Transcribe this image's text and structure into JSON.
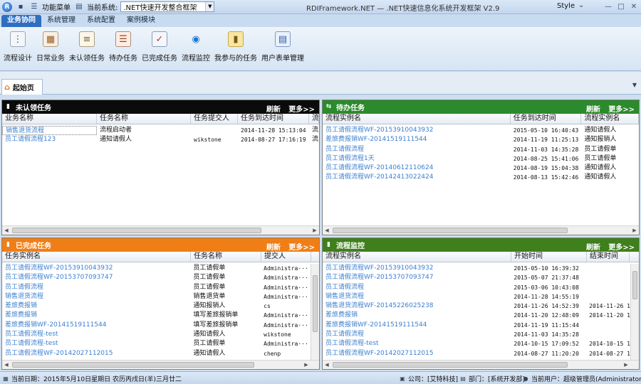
{
  "titlebar": {
    "app_icon": "R",
    "menu_label": "功能菜单",
    "system_label": "当前系统:",
    "system_value": ".NET快速开发整合框架",
    "title": "RDIFramework.NET — .NET快速信息化系统开发框架 V2.9",
    "style_label": "Style",
    "icons": [
      "logo-icon",
      "save-icon",
      "menu-icon",
      "dropdown-icon",
      "minimize-icon",
      "maximize-icon",
      "close-icon"
    ]
  },
  "ribbon_tabs": [
    "业务协同",
    "系统管理",
    "系统配置",
    "案例模块"
  ],
  "ribbon_buttons": [
    "流程设计",
    "日常业务",
    "未认领任务",
    "待办任务",
    "已完成任务",
    "流程监控",
    "我参与的任务",
    "用户表单管理"
  ],
  "doc_tab": "起始页",
  "panels": {
    "unclaimed": {
      "title": "未认领任务",
      "refresh": "刷新",
      "more": "更多>>",
      "columns": [
        "业务名称",
        "任务名称",
        "任务提交人",
        "任务到达时间",
        "流"
      ],
      "rows": [
        [
          "销售退货流程",
          "流程启动者",
          "",
          "2014-11-28 15:13:04",
          "流"
        ],
        [
          "员工请假流程123",
          "通知请假人",
          "wikstone",
          "2014-08-27 17:16:19",
          "流"
        ]
      ]
    },
    "todo": {
      "title": "待办任务",
      "refresh": "刷新",
      "more": "更多>>",
      "columns": [
        "流程实例名",
        "任务到达时间",
        "流程实例名"
      ],
      "rows": [
        [
          "员工请假流程WF-20153910043932",
          "2015-05-10 16:40:43",
          "通知请假人"
        ],
        [
          "差旅费报销WF-20141519111544",
          "2014-11-19 11:25:13",
          "通知报销人"
        ],
        [
          "员工请假流程",
          "2014-11-03 14:35:28",
          "员工请假单"
        ],
        [
          "员工请假流程1天",
          "2014-08-25 15:41:06",
          "员工请假单"
        ],
        [
          "员工请假流程WF-20140612110624",
          "2014-08-19 15:04:38",
          "通知请假人"
        ],
        [
          "员工请假流程WF-20142413022424",
          "2014-08-13 15:42:46",
          "通知请假人"
        ]
      ]
    },
    "completed": {
      "title": "已完成任务",
      "refresh": "刷新",
      "more": "更多>>",
      "columns": [
        "任务实例名",
        "任务名称",
        "提交人"
      ],
      "rows": [
        [
          "员工请假流程WF-20153910043932",
          "员工请假单",
          "Administra···"
        ],
        [
          "员工请假流程WF-20153707093747",
          "员工请假单",
          "Administra···"
        ],
        [
          "员工请假流程",
          "员工请假单",
          "Administra···"
        ],
        [
          "销售退货流程",
          "销售退货单",
          "Administra···"
        ],
        [
          "差旅费报销",
          "通知报销人",
          "cs"
        ],
        [
          "差旅费报销",
          "填写差旅报销单",
          "Administra···"
        ],
        [
          "差旅费报销WF-20141519111544",
          "填写差旅报销单",
          "Administra···"
        ],
        [
          "员工请假流程-test",
          "通知请假人",
          "wikstone"
        ],
        [
          "员工请假流程-test",
          "员工请假单",
          "Administra···"
        ],
        [
          "员工请假流程WF-20142027112015",
          "通知请假人",
          "chenp"
        ]
      ]
    },
    "monitor": {
      "title": "流程监控",
      "refresh": "刷新",
      "more": "更多>>",
      "columns": [
        "流程实例名",
        "开始时间",
        "结束时间"
      ],
      "rows": [
        [
          "员工请假流程WF-20153910043932",
          "2015-05-10 16:39:32",
          ""
        ],
        [
          "员工请假流程WF-20153707093747",
          "2015-05-07 21:37:48",
          ""
        ],
        [
          "员工请假流程",
          "2015-03-06 10:43:08",
          ""
        ],
        [
          "销售退货流程",
          "2014-11-28 14:55:19",
          ""
        ],
        [
          "销售退货流程WF-20145226025238",
          "2014-11-26 14:52:39",
          "2014-11-26 14"
        ],
        [
          "差旅费报销",
          "2014-11-20 12:48:09",
          "2014-11-20 13"
        ],
        [
          "差旅费报销WF-20141519111544",
          "2014-11-19 11:15:44",
          ""
        ],
        [
          "员工请假流程",
          "2014-11-03 14:35:28",
          ""
        ],
        [
          "员工请假流程-test",
          "2014-10-15 17:09:52",
          "2014-10-15 17"
        ],
        [
          "员工请假流程WF-20142027112015",
          "2014-08-27 11:20:20",
          "2014-08-27 11"
        ]
      ]
    }
  },
  "statusbar": {
    "date": "当前日期：2015年5月10日星期日 农历丙戌日(羊)三月廿二",
    "company": "公司：[艾特科技]",
    "department": "部门：[系统开发部]",
    "user": "当前用户：超级管理员(Administrator)"
  }
}
